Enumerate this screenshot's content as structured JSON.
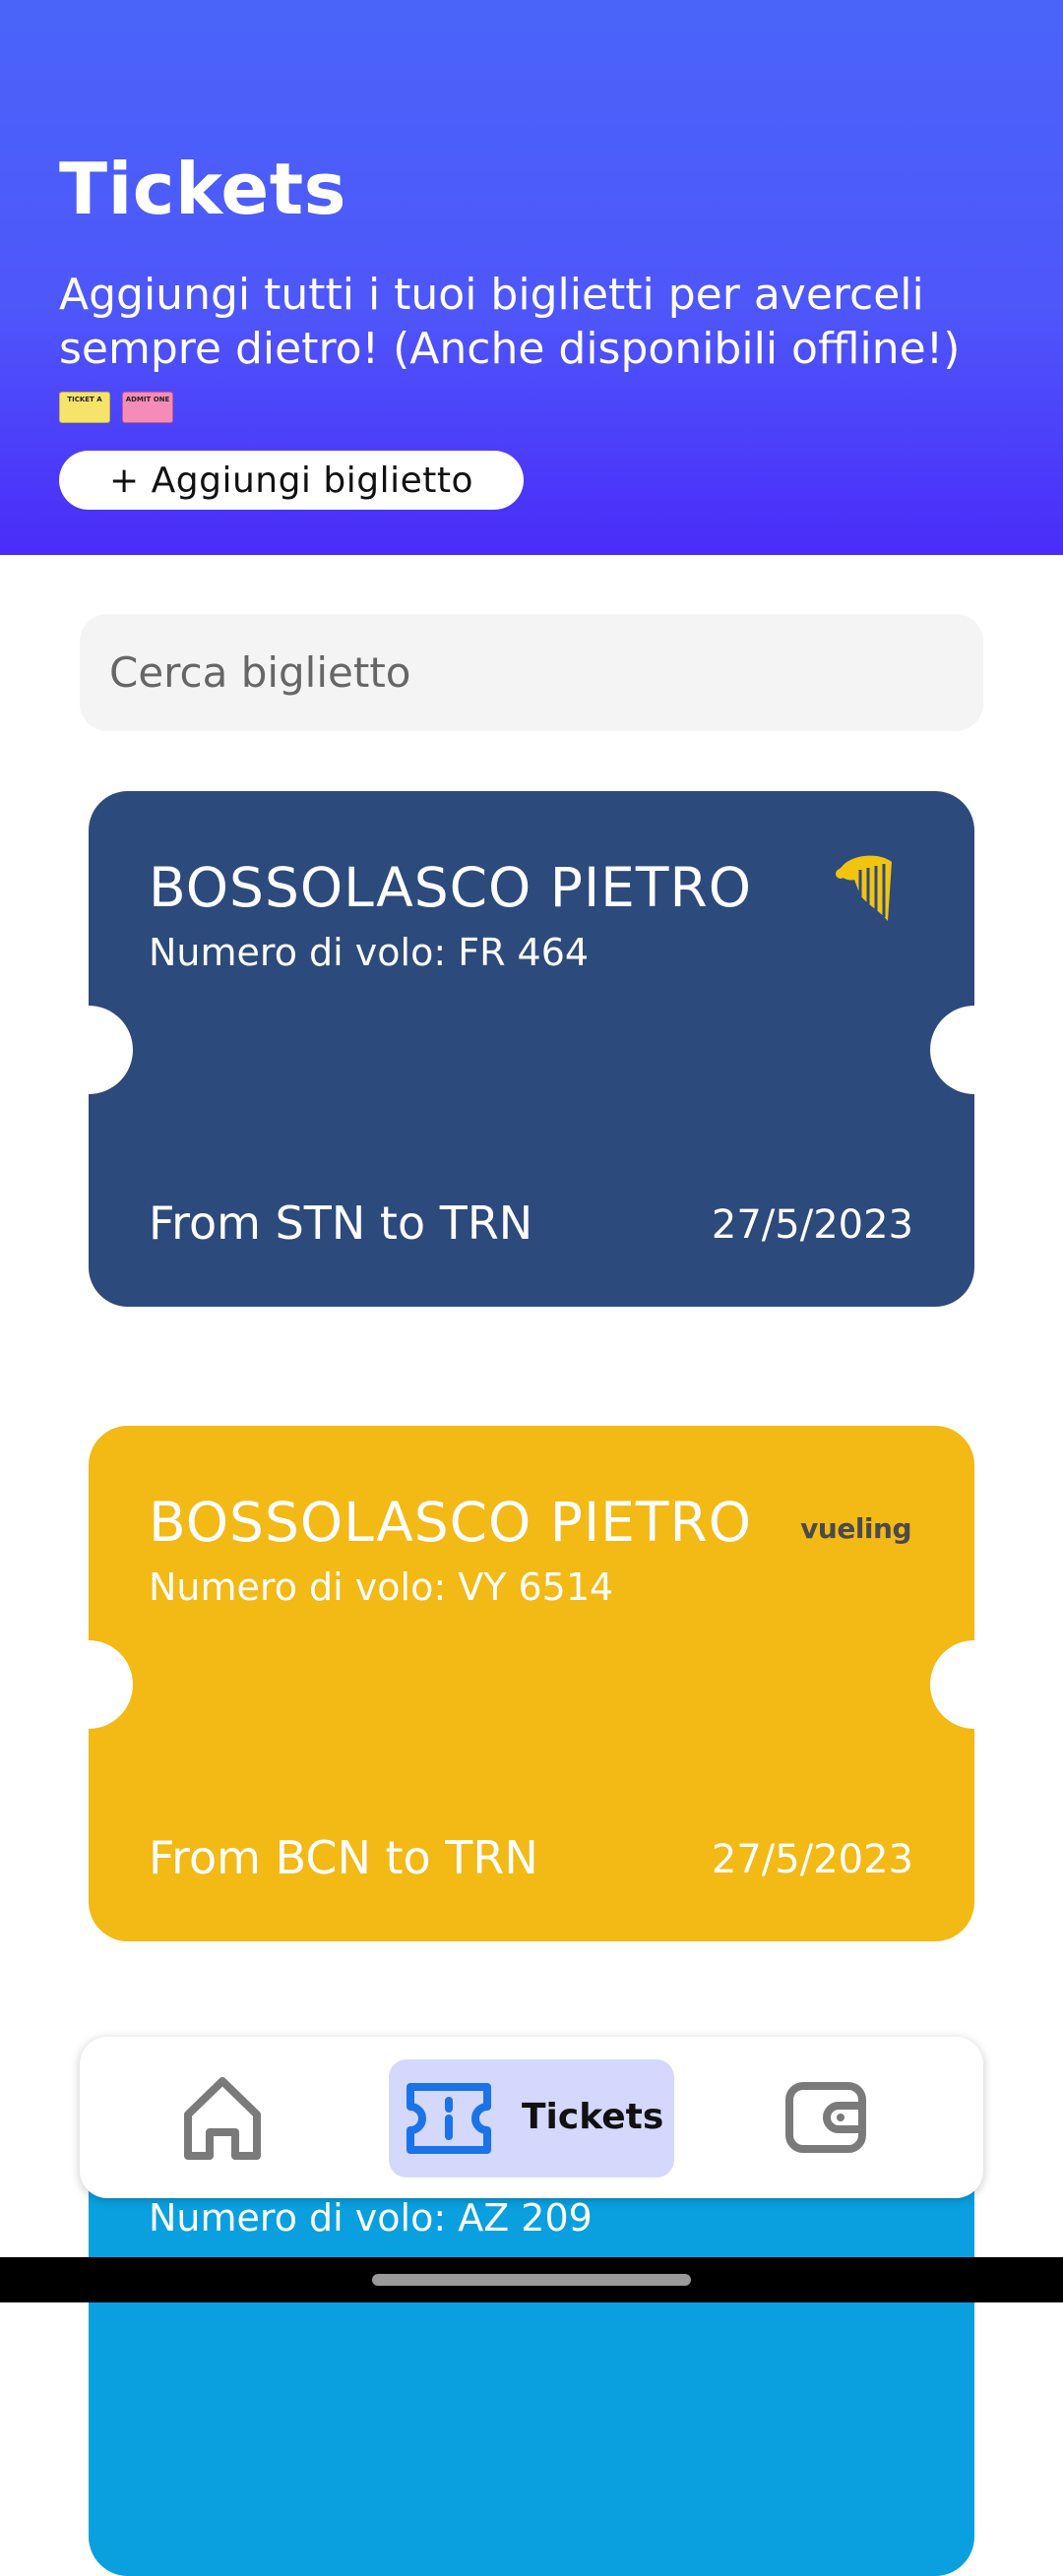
{
  "header": {
    "title": "Tickets",
    "subtitle": "Aggiungi tutti i tuoi biglietti per averceli sempre dietro! (Anche disponibili offline!)",
    "emoji_1": "TICKET A",
    "emoji_2": "ADMIT ONE",
    "add_button_label": "+ Aggiungi biglietto",
    "gradient_top": "#4a64f9",
    "gradient_bottom": "#4a2cf9"
  },
  "search": {
    "placeholder": "Cerca biglietto"
  },
  "tickets": [
    {
      "name": "BOSSOLASCO PIETRO",
      "flight": "Numero di volo: FR 464",
      "route": "From STN to TRN",
      "date": "27/5/2023",
      "logo": "ryanair-harp-icon",
      "color": "#2d4a7c"
    },
    {
      "name": "BOSSOLASCO PIETRO",
      "flight": "Numero di volo: VY 6514",
      "route": "From BCN to TRN",
      "date": "27/5/2023",
      "logo": "vueling",
      "color": "#f3b915"
    },
    {
      "flight": "Numero di volo: AZ 209",
      "color": "#0aa0e0"
    }
  ],
  "navbar": {
    "home_icon": "home-icon",
    "active_label": "Tickets",
    "active_icon": "ticket-icon",
    "wallet_icon": "wallet-icon",
    "active_bg": "#d4d8fc",
    "accent": "#1a73e8"
  }
}
